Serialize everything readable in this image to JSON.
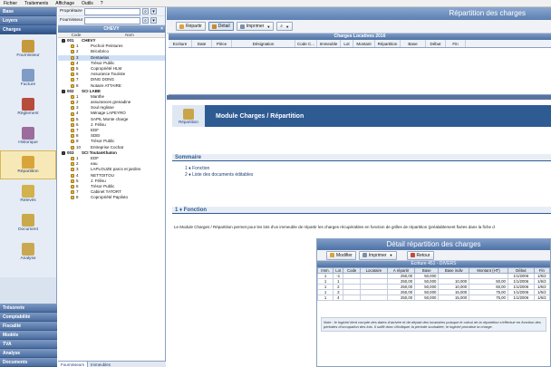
{
  "menu": {
    "items": [
      "Fichier",
      "Traitements",
      "Affichage",
      "Outils",
      "?"
    ]
  },
  "leftnav": {
    "top_headers": [
      "Base",
      "Loyers",
      "Charges"
    ],
    "items": [
      {
        "label": "Fournisseur",
        "icon": "supplier-icon"
      },
      {
        "label": "Facture",
        "icon": "invoice-icon"
      },
      {
        "label": "Règlement",
        "icon": "payment-icon"
      },
      {
        "label": "Historique",
        "icon": "history-icon"
      },
      {
        "label": "Répartition",
        "icon": "distribution-icon"
      },
      {
        "label": "Relevés",
        "icon": "statements-icon"
      },
      {
        "label": "Document",
        "icon": "document-icon"
      },
      {
        "label": "Analyse",
        "icon": "analysis-icon"
      }
    ],
    "bottom_headers": [
      "Trésorerie",
      "Comptabilité",
      "Fiscalité",
      "Modèle",
      "TVA",
      "Analyse",
      "Documents"
    ]
  },
  "filters": {
    "proprietaire_label": "Propriétaire",
    "fournisseur_label": "Fournisseur"
  },
  "tree": {
    "title": "CHEVY",
    "col_code": "Code",
    "col_nom": "Nom",
    "rows": [
      {
        "code": "001",
        "name": "CHEVY",
        "group": true
      },
      {
        "code": "1",
        "name": "Pochoir Peintures"
      },
      {
        "code": "2",
        "name": "Bricobrico"
      },
      {
        "code": "3",
        "name": "Dentaelas",
        "selected": true
      },
      {
        "code": "4",
        "name": "Trésor Public"
      },
      {
        "code": "5",
        "name": "Copropriété HLM"
      },
      {
        "code": "6",
        "name": "Assurance Touriste"
      },
      {
        "code": "7",
        "name": "DING DONG"
      },
      {
        "code": "8",
        "name": "Notaire ATTAIRE"
      },
      {
        "code": "002",
        "name": "SCI LABE",
        "group": true
      },
      {
        "code": "1",
        "name": "Manthe"
      },
      {
        "code": "2",
        "name": "assurances grenadine"
      },
      {
        "code": "3",
        "name": "Soul reglisse"
      },
      {
        "code": "4",
        "name": "Ménage LAPEYRO"
      },
      {
        "code": "5",
        "name": "SAPIL Monte charge"
      },
      {
        "code": "6",
        "name": "J. Félisu"
      },
      {
        "code": "7",
        "name": "EDF"
      },
      {
        "code": "8",
        "name": "SDEI"
      },
      {
        "code": "9",
        "name": "Trésor Public"
      },
      {
        "code": "10",
        "name": "Entreprise Cochat"
      },
      {
        "code": "003",
        "name": "SCI ToutanKhaton",
        "group": true
      },
      {
        "code": "1",
        "name": "EDF"
      },
      {
        "code": "2",
        "name": "eau"
      },
      {
        "code": "3",
        "name": "LAPLOUZE parcs et jardins"
      },
      {
        "code": "4",
        "name": "NETTOITOU"
      },
      {
        "code": "5",
        "name": "J. Félisu"
      },
      {
        "code": "6",
        "name": "Trésor Public"
      },
      {
        "code": "7",
        "name": "Cabinet TATORT"
      },
      {
        "code": "8",
        "name": "Copropriété Papiloto"
      }
    ],
    "tabs": [
      "Fournisseurs",
      "Immeubles"
    ]
  },
  "main": {
    "title": "Répartition des charges",
    "toolbar": {
      "repartir": "Répartir",
      "detail": "Détail",
      "imprimer": "Imprimer"
    },
    "charges_title": "Charges Locatives 2016",
    "charges_cols": [
      "Ecriture",
      "Date",
      "Pièce",
      "Désignation",
      "Code C...",
      "Immeuble",
      "Lot",
      "Montant",
      "Répartition",
      "Base",
      "Début",
      "Fin"
    ]
  },
  "help": {
    "module_title": "Module Charges / Répartition",
    "module_icon_label": "Répartition",
    "sommaire_title": "Sommaire",
    "toc": [
      "1 ♦ Fonction",
      "2 ♦ Liste des documents éditables"
    ],
    "fonction_title": "1 ♦ Fonction",
    "fonction_text": "Le Module Charges / Répartition permet pour les lots d'un immeuble de répartir les charges récupérables en fonction de grilles de répartition (préalablement fixées dans la fiche d",
    "detail": {
      "title": "Détail répartition des charges",
      "toolbar": {
        "modifier": "Modifier",
        "imprimer": "Imprimer",
        "retour": "Retour"
      },
      "subtitle": "Ecriture 451 - DIVERS",
      "cols": [
        "Imm.",
        "Lot",
        "Code",
        "Locataire",
        "A répartir",
        "Base",
        "Base indiv",
        "Montant (HT)",
        "Début",
        "Fin"
      ],
      "rows": [
        [
          "1",
          "-1",
          "",
          "",
          "250,00",
          "50,000",
          "",
          "",
          "1/1/2006",
          "1/6/2"
        ],
        [
          "1",
          "1",
          "",
          "",
          "250,00",
          "50,000",
          "10,000",
          "50,00",
          "1/1/2006",
          "1/6/2"
        ],
        [
          "1",
          "2",
          "",
          "",
          "250,00",
          "50,000",
          "10,000",
          "50,00",
          "1/1/2006",
          "1/6/2"
        ],
        [
          "1",
          "3",
          "",
          "",
          "250,00",
          "50,000",
          "15,000",
          "75,00",
          "1/1/2006",
          "1/6/2"
        ],
        [
          "1",
          "4",
          "",
          "",
          "250,00",
          "50,000",
          "15,000",
          "75,00",
          "1/1/2006",
          "1/6/2"
        ]
      ],
      "note": "Note : le logiciel tient compte des dates d'arrivée et de départ des locataires puisque le calcul de la répartition s'effectue en fonction des périodes d'occupation des lots. Il suffit donc d'indiquer la période souhaitée, le logiciel proratise la charge."
    }
  },
  "colors": {
    "accent": "#2f5b93",
    "selection": "#f7e9b7",
    "header": "#5b7fb2"
  }
}
